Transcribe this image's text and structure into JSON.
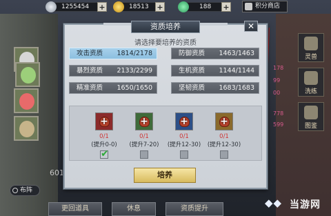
{
  "resources": [
    {
      "icon": "silver-coin-icon",
      "value": "1255454"
    },
    {
      "icon": "gold-coin-icon",
      "value": "18513"
    },
    {
      "icon": "green-gem-icon",
      "value": "188"
    }
  ],
  "shop_label": "积分商店",
  "dialog": {
    "title": "资质培养",
    "subtitle": "请选择要培养的资质",
    "stats": [
      {
        "name": "攻击资质",
        "value": "1814/2178",
        "active": true
      },
      {
        "name": "防御资质",
        "value": "1463/1463",
        "active": false
      },
      {
        "name": "暴烈资质",
        "value": "2133/2299",
        "active": false
      },
      {
        "name": "生机资质",
        "value": "1144/1144",
        "active": false
      },
      {
        "name": "精准资质",
        "value": "1650/1650",
        "active": false
      },
      {
        "name": "坚韧资质",
        "value": "1683/1683",
        "active": false
      }
    ],
    "items": [
      {
        "count": "0/1",
        "range": "(提升0-0)",
        "frame": "#8b2b2b",
        "checked": true
      },
      {
        "count": "0/1",
        "range": "(提升7-20)",
        "frame": "#3f6b3a",
        "checked": false
      },
      {
        "count": "0/1",
        "range": "(提升12-30)",
        "frame": "#2c4f87",
        "checked": false
      },
      {
        "count": "0/1",
        "range": "(提升12-30)",
        "frame": "#8a6a2c",
        "checked": false
      }
    ],
    "train_label": "培养"
  },
  "left": {
    "formation_label": "布阵",
    "number": "601"
  },
  "bottom_buttons": [
    "更回道具",
    "休息",
    "资质提升"
  ],
  "right_tabs": [
    "灵兽",
    "洗练",
    "图鉴"
  ],
  "right_numbers": [
    "178",
    "99",
    "00",
    "778",
    "599"
  ],
  "watermark": "当游网"
}
